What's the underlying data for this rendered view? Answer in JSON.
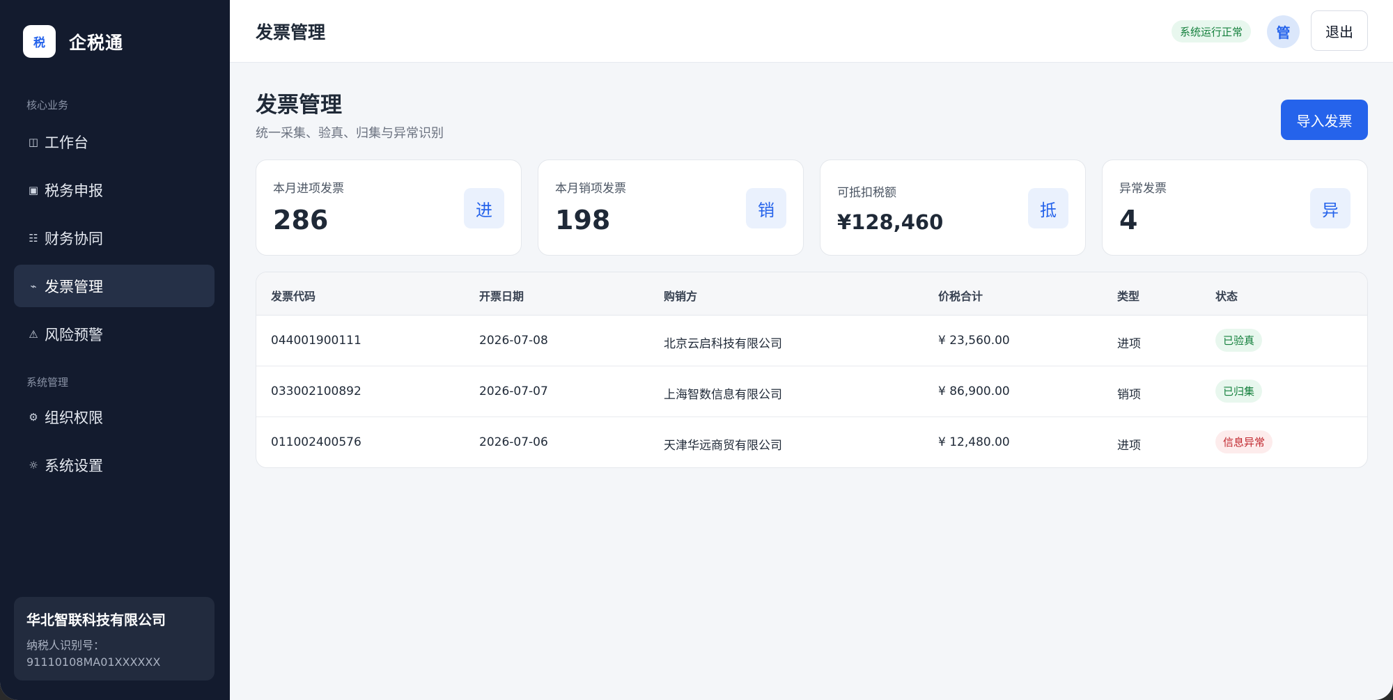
{
  "sidebar": {
    "brand_logo": "税",
    "brand_name": "企税通",
    "sections": [
      {
        "label": "核心业务",
        "items": [
          {
            "icon": "◫",
            "label": "工作台",
            "active": false
          },
          {
            "icon": "▣",
            "label": "税务申报",
            "active": false
          },
          {
            "icon": "☷",
            "label": "财务协同",
            "active": false
          },
          {
            "icon": "⌁",
            "label": "发票管理",
            "active": true
          },
          {
            "icon": "⚠",
            "label": "风险预警",
            "active": false
          }
        ]
      },
      {
        "label": "系统管理",
        "items": [
          {
            "icon": "⚙",
            "label": "组织权限",
            "active": false
          },
          {
            "icon": "☼",
            "label": "系统设置",
            "active": false
          }
        ]
      }
    ],
    "company": {
      "name": "华北智联科技有限公司",
      "taxid_label": "纳税人识别号：",
      "taxid": "91110108MA01XXXXXX"
    }
  },
  "header": {
    "title": "发票管理",
    "status": "系统运行正常",
    "avatar": "管",
    "logout_label": "退出"
  },
  "page": {
    "title": "发票管理",
    "subtitle": "统一采集、验真、归集与异常识别",
    "import_label": "导入发票"
  },
  "stats": [
    {
      "label": "本月进项发票",
      "value": "286",
      "icon": "进"
    },
    {
      "label": "本月销项发票",
      "value": "198",
      "icon": "销"
    },
    {
      "label": "可抵扣税额",
      "value": "¥128,460",
      "icon": "抵"
    },
    {
      "label": "异常发票",
      "value": "4",
      "icon": "异"
    }
  ],
  "table": {
    "columns": [
      "发票代码",
      "开票日期",
      "购销方",
      "价税合计",
      "类型",
      "状态"
    ],
    "rows": [
      {
        "code": "044001900111",
        "date": "2026-07-08",
        "party": "北京云启科技有限公司",
        "amount": "¥ 23,560.00",
        "type": "进项",
        "status": "已验真",
        "status_kind": "ok"
      },
      {
        "code": "033002100892",
        "date": "2026-07-07",
        "party": "上海智数信息有限公司",
        "amount": "¥ 86,900.00",
        "type": "销项",
        "status": "已归集",
        "status_kind": "ok"
      },
      {
        "code": "011002400576",
        "date": "2026-07-06",
        "party": "天津华远商贸有限公司",
        "amount": "¥ 12,480.00",
        "type": "进项",
        "status": "信息异常",
        "status_kind": "err"
      }
    ]
  },
  "colors": {
    "sidebar_bg": "#131b2e",
    "accent": "#2563eb",
    "ok": "#15803d",
    "error": "#c0262d"
  }
}
